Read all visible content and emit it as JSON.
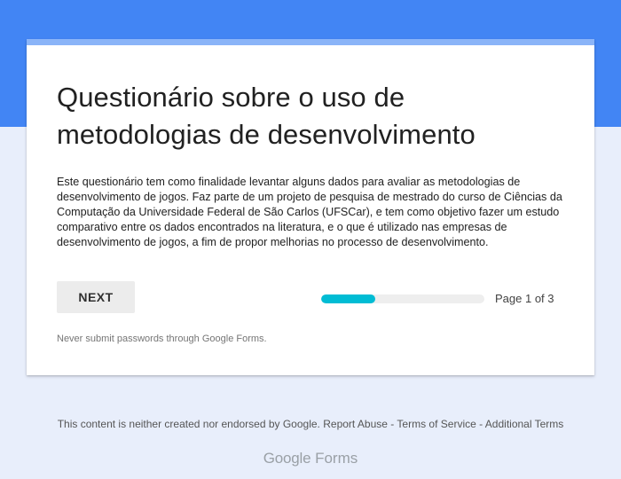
{
  "colors": {
    "header_band": "#4285f4",
    "card_accent": "#8ab4f8",
    "page_background": "#e8eefb",
    "progress_fill": "#00bcd4"
  },
  "form": {
    "title": "Questionário sobre o uso de metodologias de desenvolvimento",
    "description": "Este questionário tem como finalidade levantar alguns dados para avaliar as metodologias de desenvolvimento de jogos. Faz parte de um projeto de pesquisa de mestrado do curso de Ciências da Computação da Universidade Federal de São Carlos (UFSCar), e tem como objetivo fazer um estudo comparativo entre os dados encontrados na literatura, e o que é utilizado nas empresas de desenvolvimento de jogos, a fim de propor melhorias no processo de desenvolvimento.",
    "next_label": "NEXT",
    "progress_fraction": 0.3333,
    "page_indicator": "Page 1 of 3",
    "password_warning": "Never submit passwords through Google Forms."
  },
  "footer": {
    "disclaimer": "This content is neither created nor endorsed by Google.",
    "report_abuse": "Report Abuse",
    "separator": "-",
    "terms_of_service": "Terms of Service",
    "additional_terms": "Additional Terms"
  },
  "brand": {
    "google": "Google",
    "forms": "Forms"
  }
}
